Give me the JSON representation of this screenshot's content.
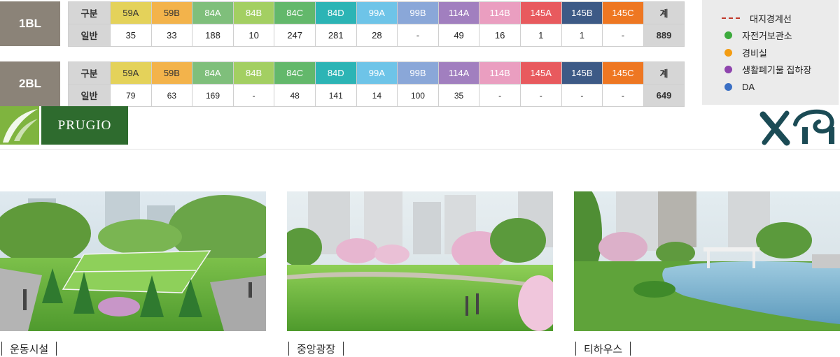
{
  "blocks": [
    {
      "name": "1BL",
      "header_label": "구분",
      "row_label": "일반",
      "units": [
        "59A",
        "59B",
        "84A",
        "84B",
        "84C",
        "84D",
        "99A",
        "99B",
        "114A",
        "114B",
        "145A",
        "145B",
        "145C"
      ],
      "counts": [
        "35",
        "33",
        "188",
        "10",
        "247",
        "281",
        "28",
        "-",
        "49",
        "16",
        "1",
        "1",
        "-"
      ],
      "total_label": "계",
      "total": "889"
    },
    {
      "name": "2BL",
      "header_label": "구분",
      "row_label": "일반",
      "units": [
        "59A",
        "59B",
        "84A",
        "84B",
        "84C",
        "84D",
        "99A",
        "99B",
        "114A",
        "114B",
        "145A",
        "145B",
        "145C"
      ],
      "counts": [
        "79",
        "63",
        "169",
        "-",
        "48",
        "141",
        "14",
        "100",
        "35",
        "-",
        "-",
        "-",
        "-"
      ],
      "total_label": "계",
      "total": "649"
    }
  ],
  "unit_colors": [
    "#e4d25a",
    "#f3b34b",
    "#7fbf7b",
    "#a3cf62",
    "#63b86b",
    "#2cb4b5",
    "#6ec4e8",
    "#8aa7d8",
    "#a17fbf",
    "#ea9ec0",
    "#e85a5e",
    "#3d5a86",
    "#ee7722"
  ],
  "unit_text_colors": [
    "#333",
    "#333",
    "#fff",
    "#fff",
    "#fff",
    "#fff",
    "#fff",
    "#fff",
    "#fff",
    "#fff",
    "#fff",
    "#fff",
    "#fff"
  ],
  "legend": [
    {
      "label": "대지경계선",
      "type": "line",
      "color": "#c0392b"
    },
    {
      "label": "자전거보관소",
      "type": "dot",
      "color": "#3daa3d"
    },
    {
      "label": "경비실",
      "type": "dot",
      "color": "#f39c12"
    },
    {
      "label": "생활폐기물 집하장",
      "type": "dot",
      "color": "#8e44ad"
    },
    {
      "label": "DA",
      "type": "dot",
      "color": "#3a6fc4"
    }
  ],
  "brands": {
    "left": "PRUGIO"
  },
  "photos": [
    {
      "caption": "운동시설"
    },
    {
      "caption": "중앙광장"
    },
    {
      "caption": "티하우스"
    }
  ]
}
